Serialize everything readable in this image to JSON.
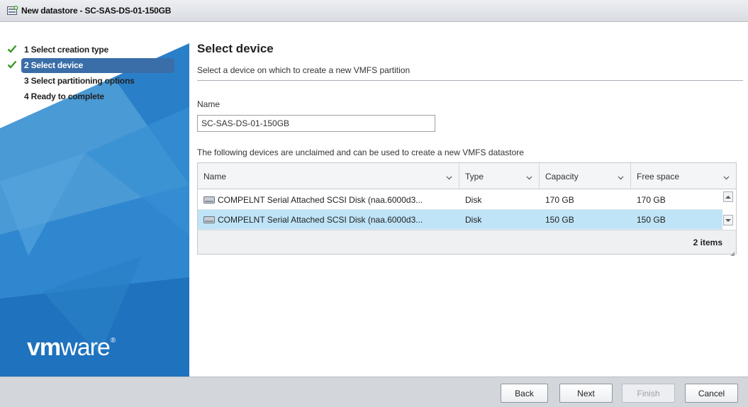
{
  "window": {
    "title": "New datastore - SC-SAS-DS-01-150GB"
  },
  "wizard": {
    "steps": [
      {
        "label": "1 Select creation type",
        "state": "completed"
      },
      {
        "label": "2 Select device",
        "state": "active"
      },
      {
        "label": "3 Select partitioning options",
        "state": "pending"
      },
      {
        "label": "4 Ready to complete",
        "state": "pending"
      }
    ],
    "logo": {
      "vm": "vm",
      "ware": "ware",
      "mark": "®"
    }
  },
  "page": {
    "title": "Select device",
    "subtitle": "Select a device on which to create a new VMFS partition",
    "name_label": "Name",
    "name_value": "SC-SAS-DS-01-150GB",
    "devices_caption": "The following devices are unclaimed and can be used to create a new VMFS datastore"
  },
  "grid": {
    "columns": [
      "Name",
      "Type",
      "Capacity",
      "Free space"
    ],
    "rows": [
      {
        "name": "COMPELNT Serial Attached SCSI Disk (naa.6000d3...",
        "type": "Disk",
        "capacity": "170 GB",
        "free": "170 GB",
        "selected": false
      },
      {
        "name": "COMPELNT Serial Attached SCSI Disk (naa.6000d3...",
        "type": "Disk",
        "capacity": "150 GB",
        "free": "150 GB",
        "selected": true
      }
    ],
    "items_count": "2 items"
  },
  "buttons": {
    "back": "Back",
    "next": "Next",
    "finish": "Finish",
    "cancel": "Cancel"
  },
  "colors": {
    "accent": "#3a6ea8",
    "selection": "#bfe3f7",
    "check": "#3a9a22",
    "panel_blue": "#1f77c4"
  }
}
